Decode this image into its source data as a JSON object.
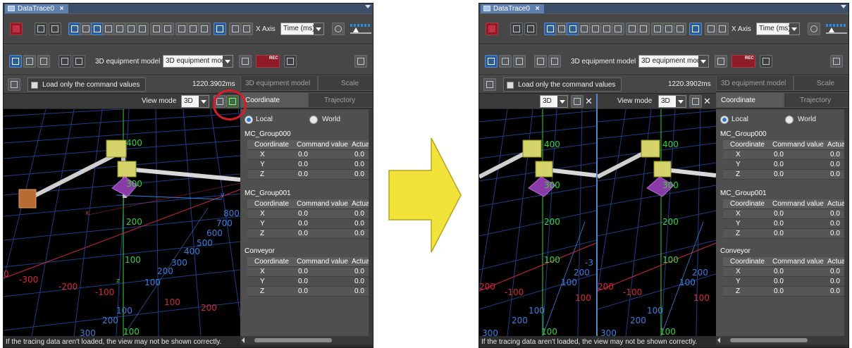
{
  "tab": {
    "title": "DataTrace0",
    "close": "×"
  },
  "toolbar": {
    "x_axis_label": "X Axis",
    "x_axis_value": "Time (ms)",
    "model_label": "3D equipment model",
    "model_value": "3D equipment model",
    "rec_label": "REC"
  },
  "command": {
    "load_label": "Load only the command values",
    "time_value": "1220.3902ms"
  },
  "side_tabs": {
    "model_tab": "3D equipment model",
    "scale_tab": "Scale",
    "coordinate_tab": "Coordinate",
    "trajectory_tab": "Trajectory"
  },
  "view": {
    "mode_label": "View mode",
    "mode_value": "3D",
    "split_mode_value": "3D",
    "close": "✕"
  },
  "coordinate": {
    "local": "Local",
    "world": "World",
    "columns": [
      "Coordinate",
      "Command value",
      "Actua"
    ],
    "groups": [
      {
        "name": "MC_Group000",
        "rows": [
          [
            "X",
            "0.0",
            "0.0"
          ],
          [
            "Y",
            "0.0",
            "0.0"
          ],
          [
            "Z",
            "0.0",
            "0.0"
          ]
        ]
      },
      {
        "name": "MC_Group001",
        "rows": [
          [
            "X",
            "0.0",
            "0.0"
          ],
          [
            "Y",
            "0.0",
            "0.0"
          ],
          [
            "Z",
            "0.0",
            "0.0"
          ]
        ]
      },
      {
        "name": "Conveyor",
        "rows": [
          [
            "X",
            "0.0",
            "0.0"
          ],
          [
            "Y",
            "0.0",
            "0.0"
          ],
          [
            "Z",
            "0.0",
            "0.0"
          ]
        ]
      }
    ]
  },
  "axis_labels": {
    "z_400": "400",
    "z_300": "300",
    "z_200": "200",
    "z_100": "100",
    "y_800": "800",
    "y_700": "700",
    "y_600": "600",
    "y_500": "500",
    "y_400": "400",
    "y_300": "300",
    "y_200": "200",
    "y_100": "100",
    "x_n300": "-300",
    "x_n200": "-200",
    "x_n100": "-100",
    "x_0": "0",
    "x_100": "100",
    "x_200": "200",
    "f_100": "100",
    "f_200": "200",
    "f_300": "300",
    "letter_x": "x",
    "letter_y": "y",
    "letter_z": "z",
    "r_200": "200",
    "r_30": "-3"
  },
  "status": {
    "text": "If the tracing data aren't loaded, the view may not be shown correctly."
  },
  "colors": {
    "accent_blue": "#2e8ae0",
    "highlight_red": "#d81d2a",
    "arrow_yellow": "#f2e33a",
    "grid_blue": "#1c3f8a",
    "x_axis": "#d6283a",
    "y_axis": "#3a7fe0",
    "z_axis": "#36d23a"
  }
}
